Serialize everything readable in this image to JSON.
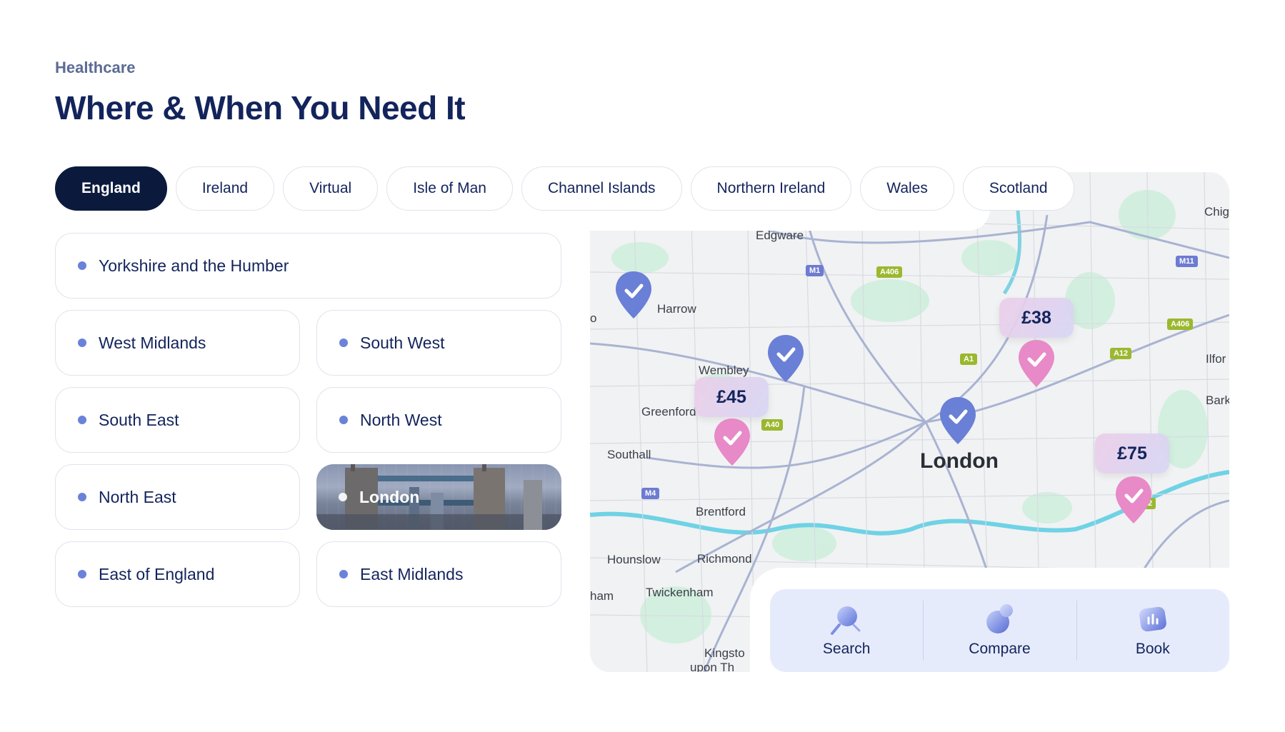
{
  "header": {
    "eyebrow": "Healthcare",
    "title": "Where & When You Need It"
  },
  "tabs": [
    {
      "label": "England",
      "active": true
    },
    {
      "label": "Ireland",
      "active": false
    },
    {
      "label": "Virtual",
      "active": false
    },
    {
      "label": "Isle of Man",
      "active": false
    },
    {
      "label": "Channel Islands",
      "active": false
    },
    {
      "label": "Northern Ireland",
      "active": false
    },
    {
      "label": "Wales",
      "active": false
    },
    {
      "label": "Scotland",
      "active": false
    }
  ],
  "regions": [
    {
      "label": "Yorkshire and the Humber"
    },
    {
      "label": "West Midlands"
    },
    {
      "label": "South West"
    },
    {
      "label": "South East"
    },
    {
      "label": "North West"
    },
    {
      "label": "North East"
    },
    {
      "label": "London",
      "selected": true
    },
    {
      "label": "East of England"
    },
    {
      "label": "East Midlands"
    }
  ],
  "map": {
    "labels": {
      "edgware": "Edgware",
      "harrow": "Harrow",
      "wembley": "Wembley",
      "greenford": "Greenford",
      "southall": "Southall",
      "brentford": "Brentford",
      "hounslow": "Hounslow",
      "richmond": "Richmond",
      "twickenham": "Twickenham",
      "kingston": "Kingsto",
      "kingston2": "upon Th",
      "london": "London",
      "chigwell": "Chig",
      "ilford": "Ilfor",
      "barking": "Barki",
      "ham": "ham",
      "o": "o"
    },
    "roads": {
      "m1": "M1",
      "m11": "M11",
      "m4": "M4",
      "a406": "A406",
      "a406b": "A406",
      "a1": "A1",
      "a12": "A12",
      "a40": "A40",
      "a2": "2"
    },
    "prices": {
      "p38": "£38",
      "p45": "£45",
      "p75": "£75"
    },
    "colors": {
      "blue_pin": "#6a7fd6",
      "pink_pin": "#e889c8"
    }
  },
  "steps": [
    {
      "label": "Search",
      "icon": "search-icon"
    },
    {
      "label": "Compare",
      "icon": "compare-icon"
    },
    {
      "label": "Book",
      "icon": "book-icon"
    }
  ]
}
